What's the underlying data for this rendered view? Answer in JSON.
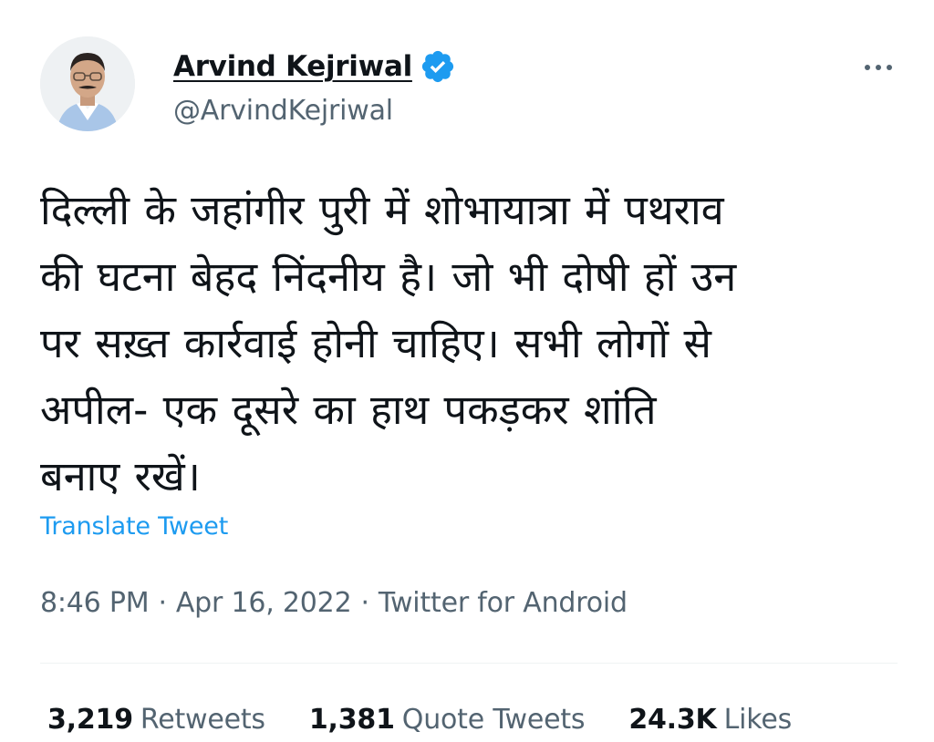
{
  "author": {
    "display_name": "Arvind Kejriwal",
    "handle": "@ArvindKejriwal",
    "verified": true,
    "badge_color": "#1d9bf0"
  },
  "tweet": {
    "lines": [
      "दिल्ली के जहांगीर पुरी में शोभायात्रा में पथराव",
      "की घटना बेहद निंदनीय है। जो भी दोषी हों उन",
      "पर सख़्त कार्रवाई होनी चाहिए। सभी लोगों से",
      "अपील- एक दूसरे का हाथ पकड़कर शांति",
      "बनाए रखें।"
    ],
    "translate_label": "Translate Tweet"
  },
  "meta": {
    "time": "8:46 PM",
    "date": "Apr 16, 2022",
    "separator": "·",
    "source": "Twitter for Android"
  },
  "stats": {
    "retweets_count": "3,219",
    "retweets_label": "Retweets",
    "quotes_count": "1,381",
    "quotes_label": "Quote Tweets",
    "likes_count": "24.3K",
    "likes_label": "Likes"
  },
  "icons": {
    "more": "more-options-icon",
    "verified": "verified-badge-icon"
  }
}
